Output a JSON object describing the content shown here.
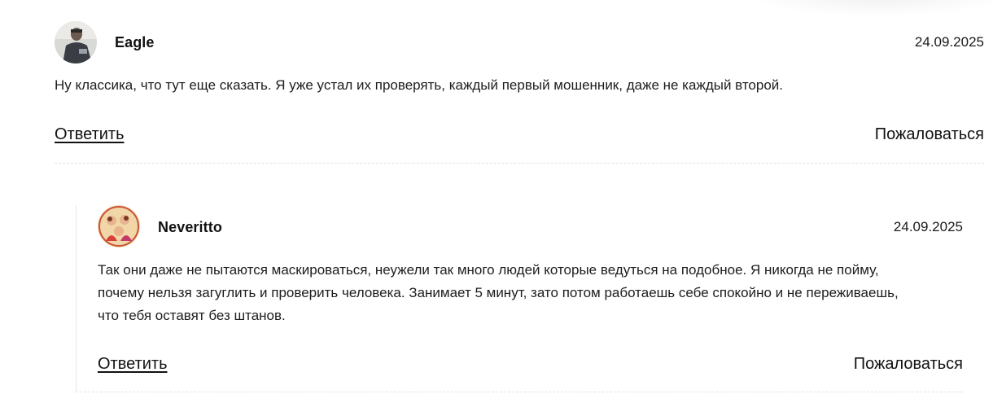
{
  "comments": [
    {
      "author": "Eagle",
      "date": "24.09.2025",
      "text": "Ну классика, что тут еще сказать. Я уже устал их проверять, каждый первый мошенник, даже не каждый второй.",
      "reply_label": "Ответить",
      "complain_label": "Пожаловаться",
      "avatar_icon": "user-photo-avatar"
    }
  ],
  "replies": [
    {
      "author": "Neveritto",
      "date": "24.09.2025",
      "text_lines": [
        "Так они даже не пытаются маскироваться, неужели так много людей которые ведуться на подобное. Я никогда не пойму,",
        "почему нельзя загуглить и проверить человека. Занимает 5 минут, зато потом работаешь себе спокойно и не переживаешь,",
        "что тебя оставят без штанов."
      ],
      "reply_label": "Ответить",
      "complain_label": "Пожаловаться",
      "avatar_icon": "illustration-avatar"
    }
  ]
}
